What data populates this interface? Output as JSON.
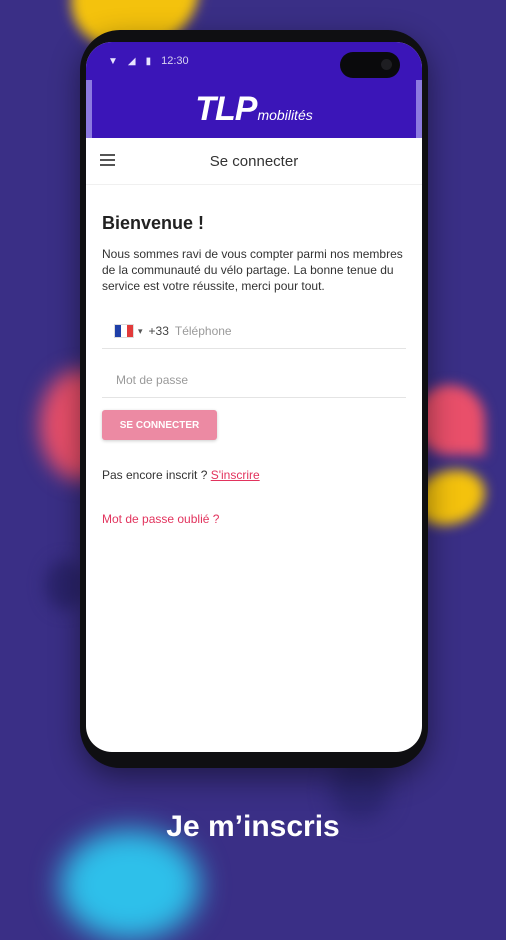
{
  "status_bar": {
    "time": "12:30"
  },
  "brand": {
    "logo_main": "TLP",
    "logo_sub": "mobilités"
  },
  "header": {
    "title": "Se connecter"
  },
  "welcome": {
    "heading": "Bienvenue !",
    "text": "Nous sommes ravi de vous compter parmi nos membres de la communauté du vélo partage. La bonne tenue du service est votre réussite, merci pour tout."
  },
  "form": {
    "country_code": "+33",
    "phone_placeholder": "Téléphone",
    "password_placeholder": "Mot de passe",
    "submit_label": "SE CONNECTER"
  },
  "register": {
    "prompt": "Pas encore inscrit ? ",
    "link": "S'inscrire"
  },
  "forgot_password": "Mot de passe oublié ?",
  "caption": "Je m’inscris",
  "colors": {
    "header": "#3b15b8",
    "accent": "#e2335d",
    "button": "#ec8aa3",
    "background": "#3a2f86"
  }
}
